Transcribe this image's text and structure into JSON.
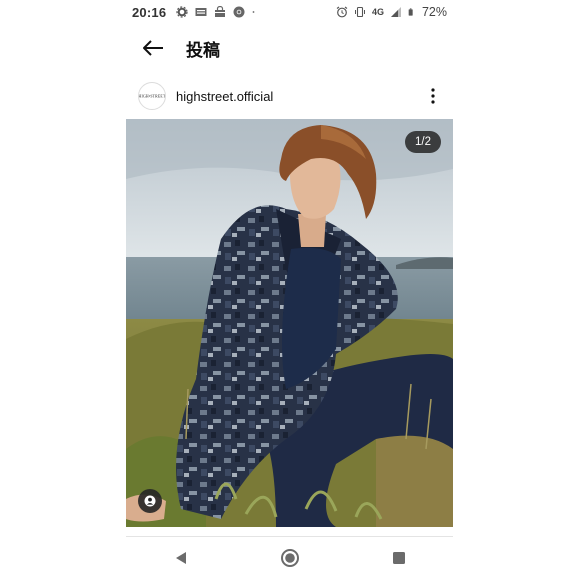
{
  "status_bar": {
    "time": "20:16",
    "network": "4G",
    "battery": "72%",
    "left_icons": [
      "settings-icon",
      "news-app-icon",
      "shopping-bag-icon",
      "chrome-icon",
      "dot-icon"
    ],
    "right_icons": [
      "alarm-icon",
      "vibrate-icon",
      "signal-icon",
      "battery-icon"
    ]
  },
  "header": {
    "back_icon": "arrow-left-icon",
    "title": "投稿"
  },
  "post": {
    "avatar_text": "HIGH STREET",
    "username": "highstreet.official",
    "more_icon": "more-vertical-icon",
    "page_indicator": "1/2",
    "tag_icon": "user-tag-icon"
  },
  "nav": {
    "buttons": [
      "back-triangle-icon",
      "home-circle-icon",
      "recents-square-icon"
    ]
  },
  "colors": {
    "sky": "#cdd6dc",
    "sea": "#7e8f98",
    "grass": "#7d7a3a",
    "jacket": "#2a3346",
    "badge_bg": "#262626"
  }
}
